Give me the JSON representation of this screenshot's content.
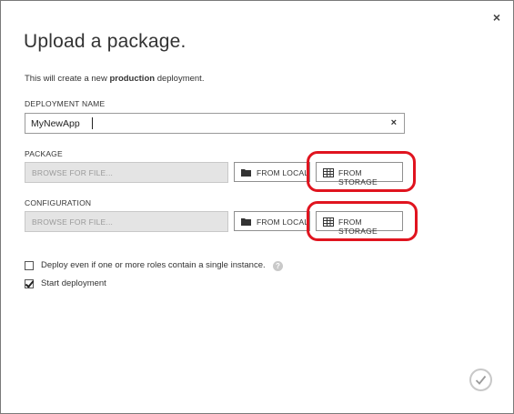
{
  "dialog": {
    "title": "Upload a package.",
    "intro_prefix": "This will create a new ",
    "intro_bold": "production",
    "intro_suffix": " deployment.",
    "close_glyph": "×"
  },
  "deployment_name": {
    "label": "DEPLOYMENT NAME",
    "value": "MyNewApp",
    "clear_glyph": "×"
  },
  "package": {
    "label": "PACKAGE",
    "browse_placeholder": "BROWSE FOR FILE...",
    "from_local_label": "FROM LOCAL",
    "from_storage_label": "FROM STORAGE"
  },
  "configuration": {
    "label": "CONFIGURATION",
    "browse_placeholder": "BROWSE FOR FILE...",
    "from_local_label": "FROM LOCAL",
    "from_storage_label": "FROM STORAGE"
  },
  "options": {
    "single_instance": {
      "label": "Deploy even if one or more roles contain a single instance.",
      "checked": false
    },
    "start_deployment": {
      "label": "Start deployment",
      "checked": true
    },
    "help_glyph": "?"
  },
  "icons": {
    "folder": "folder-icon",
    "storage": "storage-table-icon",
    "ok": "checkmark-icon"
  },
  "colors": {
    "highlight": "#e0141f",
    "browse_bg": "#e4e4e4"
  }
}
